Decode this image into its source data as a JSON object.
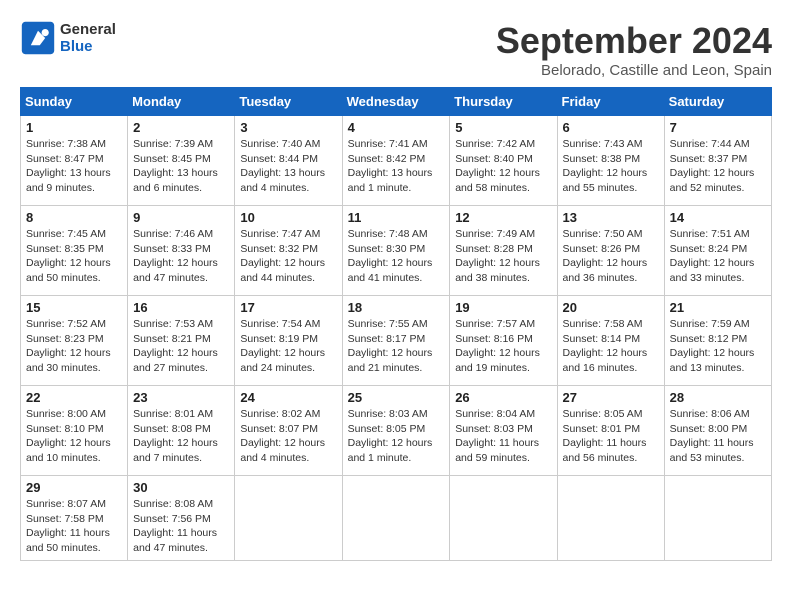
{
  "logo": {
    "general": "General",
    "blue": "Blue"
  },
  "title": "September 2024",
  "subtitle": "Belorado, Castille and Leon, Spain",
  "days": [
    "Sunday",
    "Monday",
    "Tuesday",
    "Wednesday",
    "Thursday",
    "Friday",
    "Saturday"
  ],
  "weeks": [
    [
      {
        "num": "1",
        "info": "Sunrise: 7:38 AM\nSunset: 8:47 PM\nDaylight: 13 hours\nand 9 minutes."
      },
      {
        "num": "2",
        "info": "Sunrise: 7:39 AM\nSunset: 8:45 PM\nDaylight: 13 hours\nand 6 minutes."
      },
      {
        "num": "3",
        "info": "Sunrise: 7:40 AM\nSunset: 8:44 PM\nDaylight: 13 hours\nand 4 minutes."
      },
      {
        "num": "4",
        "info": "Sunrise: 7:41 AM\nSunset: 8:42 PM\nDaylight: 13 hours\nand 1 minute."
      },
      {
        "num": "5",
        "info": "Sunrise: 7:42 AM\nSunset: 8:40 PM\nDaylight: 12 hours\nand 58 minutes."
      },
      {
        "num": "6",
        "info": "Sunrise: 7:43 AM\nSunset: 8:38 PM\nDaylight: 12 hours\nand 55 minutes."
      },
      {
        "num": "7",
        "info": "Sunrise: 7:44 AM\nSunset: 8:37 PM\nDaylight: 12 hours\nand 52 minutes."
      }
    ],
    [
      {
        "num": "8",
        "info": "Sunrise: 7:45 AM\nSunset: 8:35 PM\nDaylight: 12 hours\nand 50 minutes."
      },
      {
        "num": "9",
        "info": "Sunrise: 7:46 AM\nSunset: 8:33 PM\nDaylight: 12 hours\nand 47 minutes."
      },
      {
        "num": "10",
        "info": "Sunrise: 7:47 AM\nSunset: 8:32 PM\nDaylight: 12 hours\nand 44 minutes."
      },
      {
        "num": "11",
        "info": "Sunrise: 7:48 AM\nSunset: 8:30 PM\nDaylight: 12 hours\nand 41 minutes."
      },
      {
        "num": "12",
        "info": "Sunrise: 7:49 AM\nSunset: 8:28 PM\nDaylight: 12 hours\nand 38 minutes."
      },
      {
        "num": "13",
        "info": "Sunrise: 7:50 AM\nSunset: 8:26 PM\nDaylight: 12 hours\nand 36 minutes."
      },
      {
        "num": "14",
        "info": "Sunrise: 7:51 AM\nSunset: 8:24 PM\nDaylight: 12 hours\nand 33 minutes."
      }
    ],
    [
      {
        "num": "15",
        "info": "Sunrise: 7:52 AM\nSunset: 8:23 PM\nDaylight: 12 hours\nand 30 minutes."
      },
      {
        "num": "16",
        "info": "Sunrise: 7:53 AM\nSunset: 8:21 PM\nDaylight: 12 hours\nand 27 minutes."
      },
      {
        "num": "17",
        "info": "Sunrise: 7:54 AM\nSunset: 8:19 PM\nDaylight: 12 hours\nand 24 minutes."
      },
      {
        "num": "18",
        "info": "Sunrise: 7:55 AM\nSunset: 8:17 PM\nDaylight: 12 hours\nand 21 minutes."
      },
      {
        "num": "19",
        "info": "Sunrise: 7:57 AM\nSunset: 8:16 PM\nDaylight: 12 hours\nand 19 minutes."
      },
      {
        "num": "20",
        "info": "Sunrise: 7:58 AM\nSunset: 8:14 PM\nDaylight: 12 hours\nand 16 minutes."
      },
      {
        "num": "21",
        "info": "Sunrise: 7:59 AM\nSunset: 8:12 PM\nDaylight: 12 hours\nand 13 minutes."
      }
    ],
    [
      {
        "num": "22",
        "info": "Sunrise: 8:00 AM\nSunset: 8:10 PM\nDaylight: 12 hours\nand 10 minutes."
      },
      {
        "num": "23",
        "info": "Sunrise: 8:01 AM\nSunset: 8:08 PM\nDaylight: 12 hours\nand 7 minutes."
      },
      {
        "num": "24",
        "info": "Sunrise: 8:02 AM\nSunset: 8:07 PM\nDaylight: 12 hours\nand 4 minutes."
      },
      {
        "num": "25",
        "info": "Sunrise: 8:03 AM\nSunset: 8:05 PM\nDaylight: 12 hours\nand 1 minute."
      },
      {
        "num": "26",
        "info": "Sunrise: 8:04 AM\nSunset: 8:03 PM\nDaylight: 11 hours\nand 59 minutes."
      },
      {
        "num": "27",
        "info": "Sunrise: 8:05 AM\nSunset: 8:01 PM\nDaylight: 11 hours\nand 56 minutes."
      },
      {
        "num": "28",
        "info": "Sunrise: 8:06 AM\nSunset: 8:00 PM\nDaylight: 11 hours\nand 53 minutes."
      }
    ],
    [
      {
        "num": "29",
        "info": "Sunrise: 8:07 AM\nSunset: 7:58 PM\nDaylight: 11 hours\nand 50 minutes."
      },
      {
        "num": "30",
        "info": "Sunrise: 8:08 AM\nSunset: 7:56 PM\nDaylight: 11 hours\nand 47 minutes."
      },
      null,
      null,
      null,
      null,
      null
    ]
  ]
}
